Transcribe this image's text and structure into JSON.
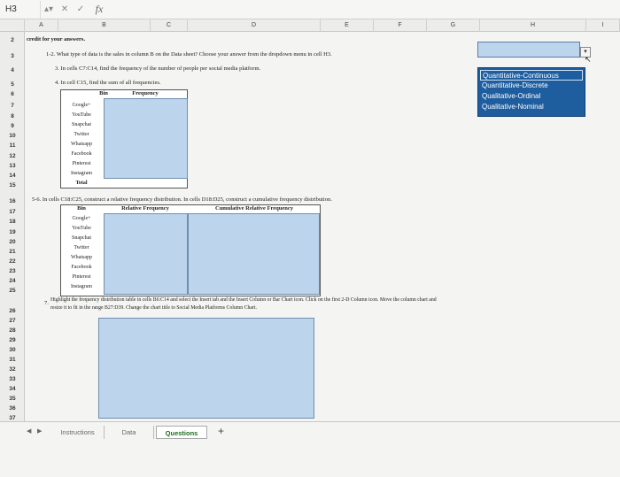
{
  "formula_bar": {
    "cell_ref": "H3",
    "fx": "fx",
    "cancel": "✕",
    "confirm": "✓"
  },
  "columns": [
    "A",
    "B",
    "C",
    "D",
    "E",
    "F",
    "G",
    "H",
    "I"
  ],
  "rows": [
    "2",
    "3",
    "4",
    "5",
    "6",
    "7",
    "8",
    "9",
    "10",
    "11",
    "12",
    "13",
    "14",
    "15",
    "16",
    "17",
    "18",
    "19",
    "20",
    "21",
    "22",
    "23",
    "24",
    "25",
    "26",
    "27",
    "28",
    "29",
    "30",
    "31",
    "32",
    "33",
    "34",
    "35",
    "36",
    "37"
  ],
  "instructions": {
    "heading": "credit for your answers.",
    "q1": "1-2.  What type of data is the sales in column B on the Data sheet?  Choose your answer from the dropdown menu in cell H3.",
    "q3": "3.  In cells C7:C14, find the frequency of the number of people per social media platform.",
    "q4": "4.  In cell C15, find the sum of all frequencies.",
    "q5": "5-6.  In cells C18:C25, construct a relative frequency distribution.  In cells D18:D25, construct a cumulative frequency distribution.",
    "q7_num": "7.",
    "q7_line1": "Highlight the frequency distribution table in cells B6:C14 and select the Insert tab and the Insert Column or Bar Chart icon.  Click on the first 2-D Column icon.  Move the column chart and",
    "q7_line2": "resize it to fit in the range B27:D39.  Change the chart title to Social Media Platforms Column Chart."
  },
  "freq_table": {
    "col_bin": "Bin",
    "col_freq": "Frequency",
    "rows": [
      "Google+",
      "YouTube",
      "Snapchat",
      "Twitter",
      "Whatsapp",
      "Facebook",
      "Pinterest",
      "Instagram"
    ],
    "total": "Total"
  },
  "rel_table": {
    "col_bin": "Bin",
    "col_rel": "Relative Frequency",
    "col_cum": "Cumulative Relative Frequency",
    "rows": [
      "Google+",
      "YouTube",
      "Snapchat",
      "Twitter",
      "Whatsapp",
      "Facebook",
      "Pinterest",
      "Instagram"
    ]
  },
  "dropdown": {
    "arrow": "▾",
    "options": [
      "Quantitative-Continuous",
      "Quantitative-Discrete",
      "Qualitative-Ordinal",
      "Qualitative-Nominal"
    ],
    "selected_index": 0
  },
  "tabs": {
    "items": [
      "Instructions",
      "Data",
      "Questions"
    ],
    "active": "Questions",
    "add": "+",
    "nav_prev": "◀",
    "nav_next": "▶"
  },
  "colors": {
    "cell_fill": "#bcd4ec",
    "dropdown_bg": "#1e5d9e",
    "active_tab_text": "#1b6d1b"
  }
}
